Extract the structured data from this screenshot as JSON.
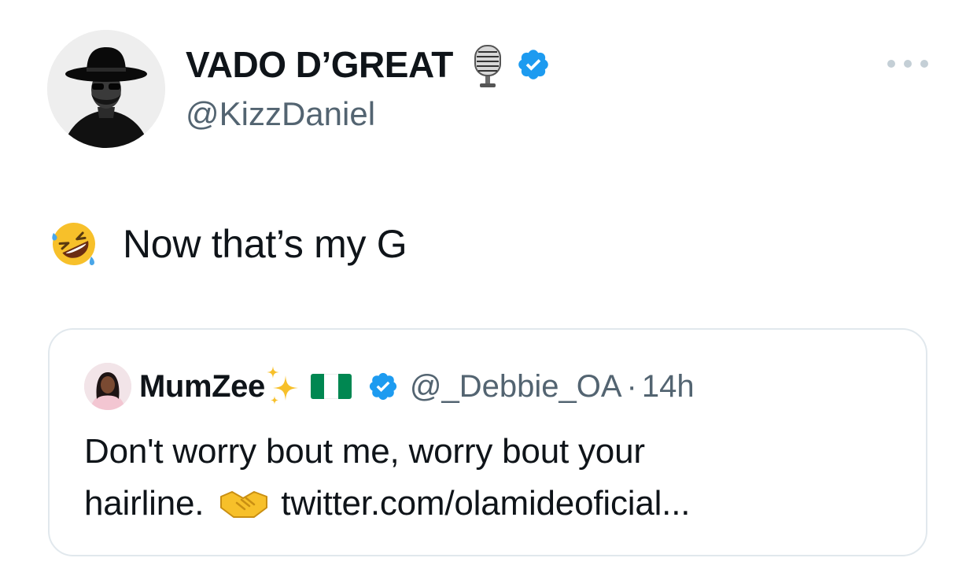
{
  "author": {
    "display_name": "VADO D’GREAT",
    "handle": "@KizzDaniel",
    "avatar_icon": "profile-photo-man-hat",
    "name_emoji": "microphone-icon",
    "verified": true
  },
  "tweet": {
    "emoji": "rolling-on-floor-laughing-icon",
    "text": "Now that’s my G"
  },
  "quoted_tweet": {
    "display_name": "MumZee",
    "name_emojis": [
      "sparkles-icon",
      "nigeria-flag-icon"
    ],
    "verified": true,
    "handle": "@_Debbie_OA",
    "separator": "·",
    "time": "14h",
    "text_line1": "Don't worry bout me, worry bout your",
    "text_line2_before": "hairline.",
    "text_line2_emoji": "handshake-icon",
    "link": "twitter.com/olamideoficial..."
  },
  "colors": {
    "verified": "#1d9bf0",
    "secondary_text": "#536471",
    "border": "#e1e8ed",
    "flag_green": "#008751"
  }
}
